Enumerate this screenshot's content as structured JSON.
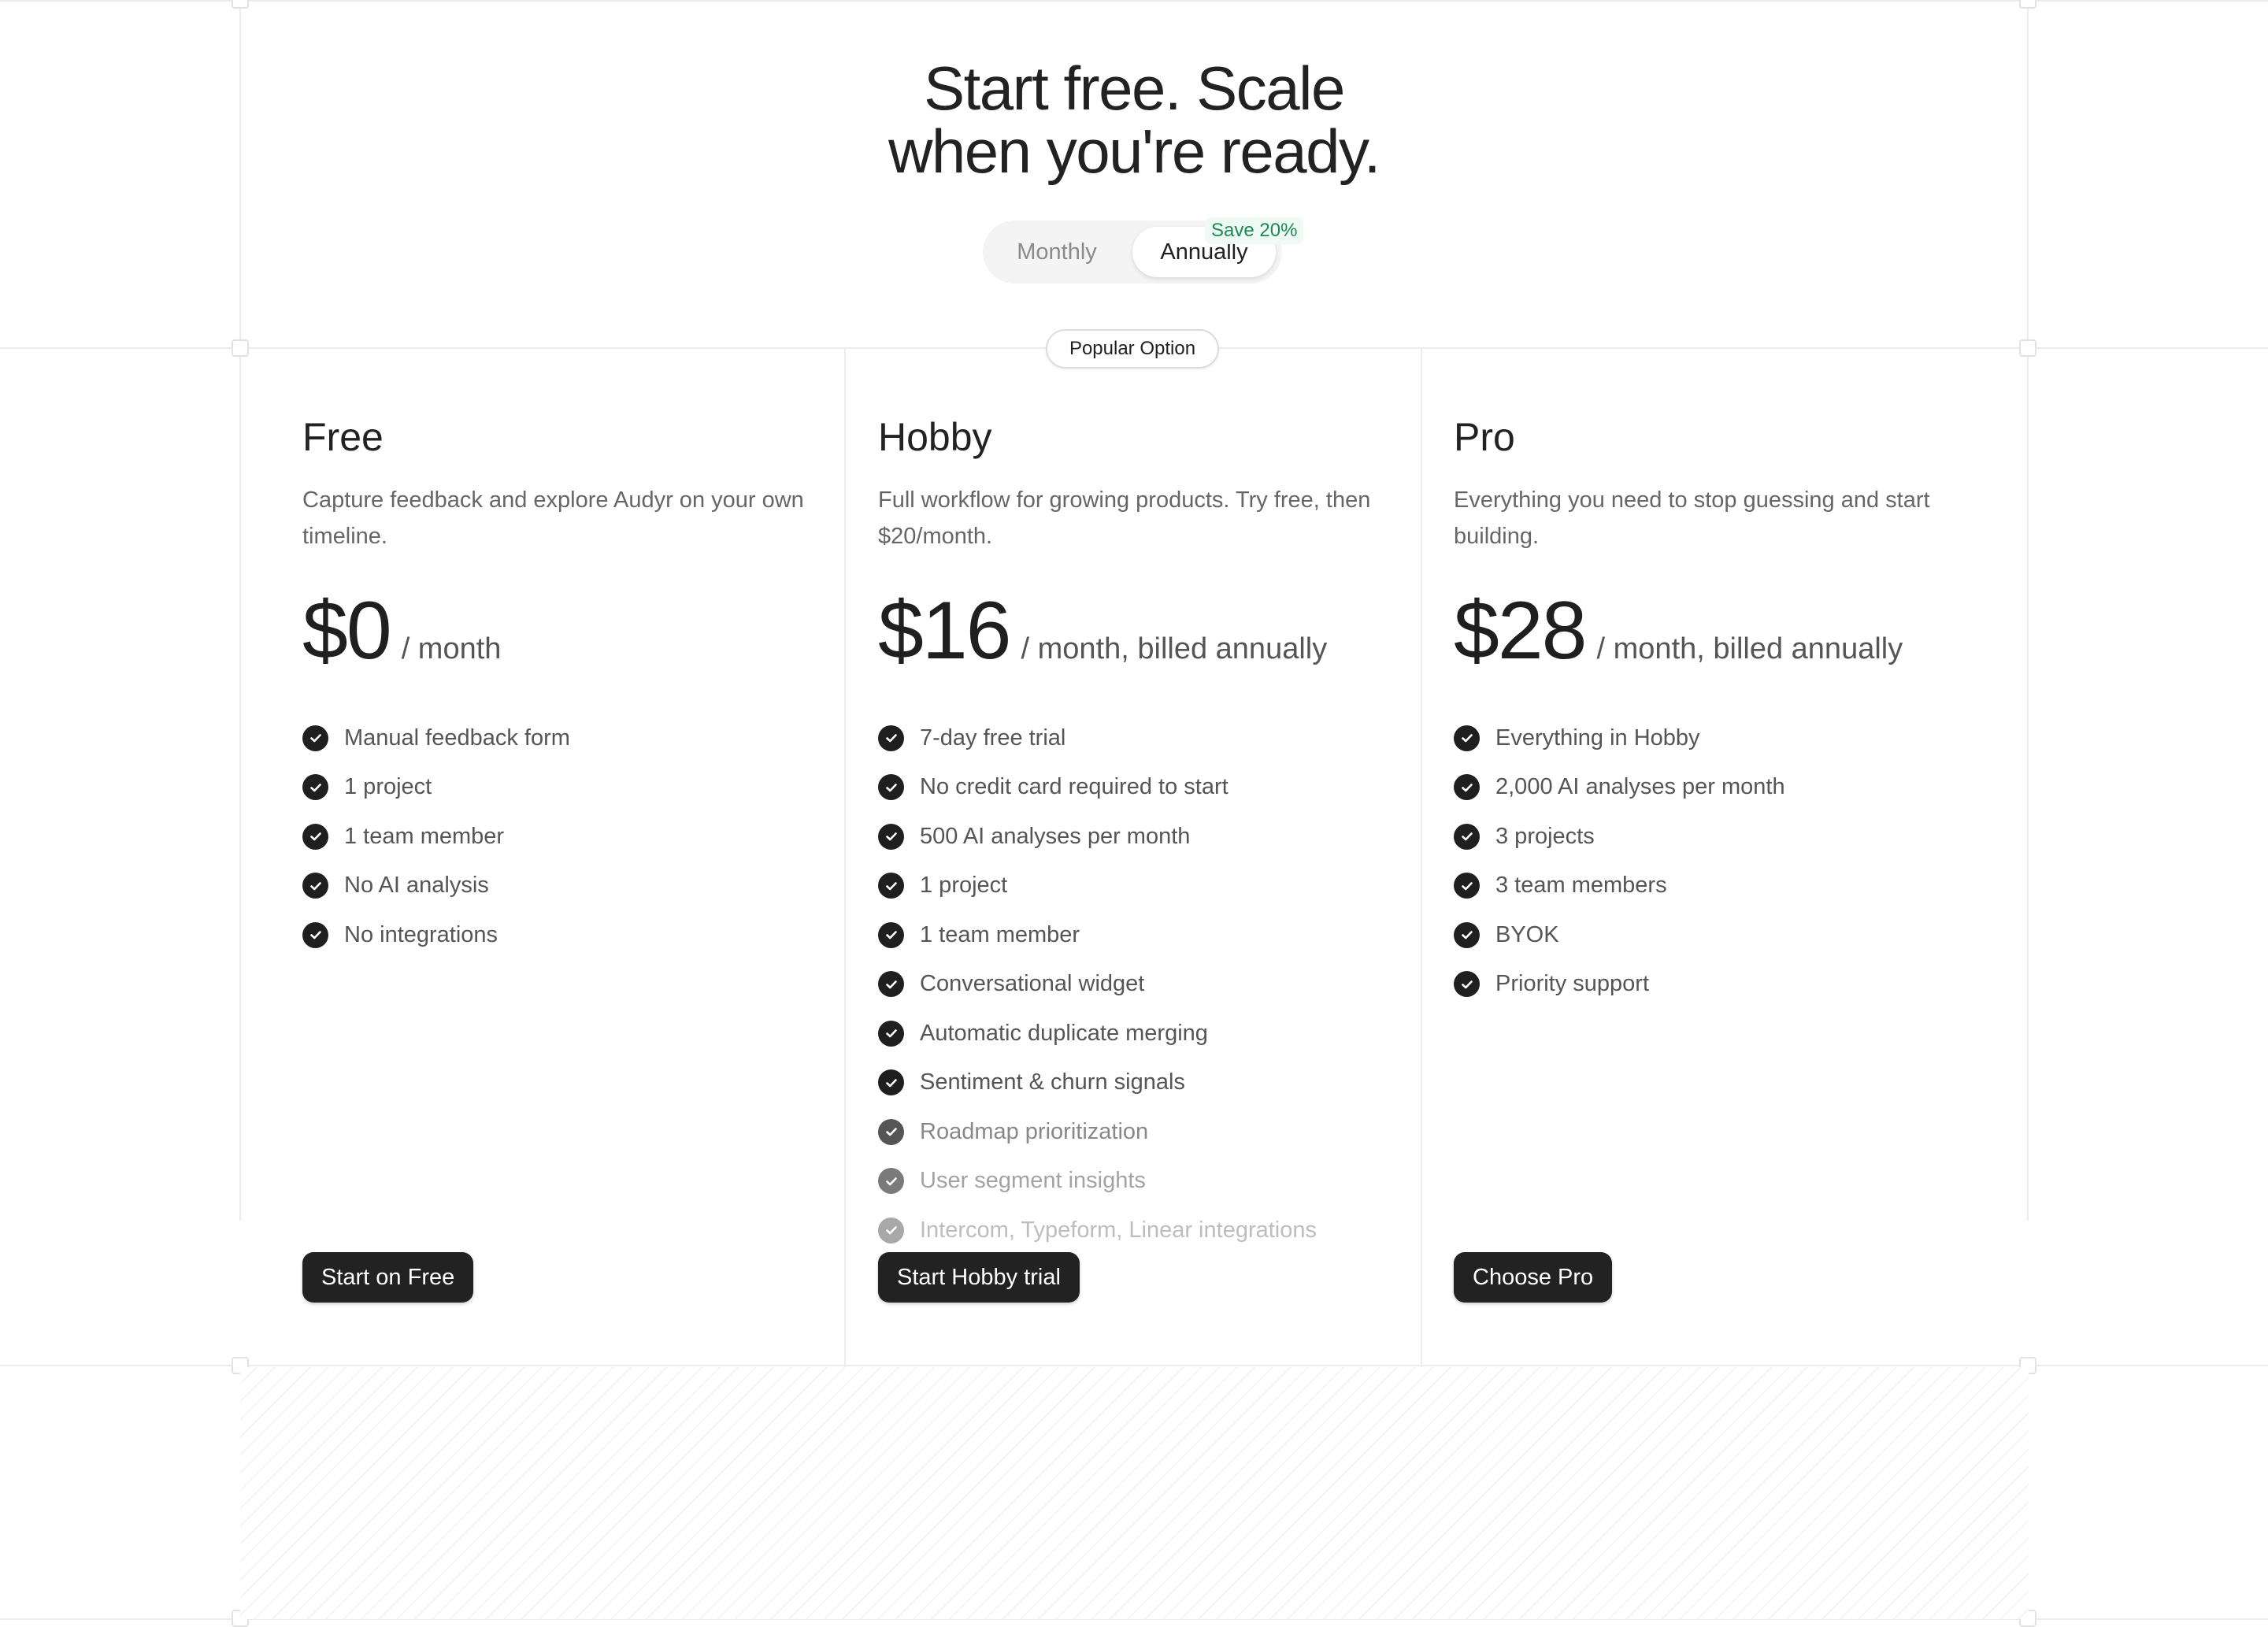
{
  "hero": {
    "title_line1": "Start free. Scale",
    "title_line2": "when you're ready."
  },
  "billing_toggle": {
    "monthly_label": "Monthly",
    "annually_label": "Annually",
    "selected": "Annually",
    "save_badge": "Save 20%"
  },
  "popular_badge": "Popular Option",
  "plans": [
    {
      "name": "Free",
      "description": "Capture feedback and explore Audyr on your own timeline.",
      "price": "$0",
      "period": "/ month",
      "features": [
        "Manual feedback form",
        "1 project",
        "1 team member",
        "No AI analysis",
        "No integrations"
      ],
      "cta": "Start on Free"
    },
    {
      "name": "Hobby",
      "description": "Full workflow for growing products. Try free, then $20/month.",
      "price": "$16",
      "period": "/ month, billed annually",
      "features": [
        "7-day free trial",
        "No credit card required to start",
        "500 AI analyses per month",
        "1 project",
        "1 team member",
        "Conversational widget",
        "Automatic duplicate merging",
        "Sentiment & churn signals",
        "Roadmap prioritization",
        "User segment insights",
        "Intercom, Typeform, Linear integrations"
      ],
      "cta": "Start Hobby trial"
    },
    {
      "name": "Pro",
      "description": "Everything you need to stop guessing and start building.",
      "price": "$28",
      "period": "/ month, billed annually",
      "features": [
        "Everything in Hobby",
        "2,000 AI analyses per month",
        "3 projects",
        "3 team members",
        "BYOK",
        "Priority support"
      ],
      "cta": "Choose Pro"
    }
  ],
  "colors": {
    "text": "#1f1f1f",
    "muted": "#666666",
    "button_bg": "#222222",
    "save_green": "#1b8a55",
    "border": "#ececec"
  },
  "icons": {
    "feature_check": "check-circle-icon"
  }
}
